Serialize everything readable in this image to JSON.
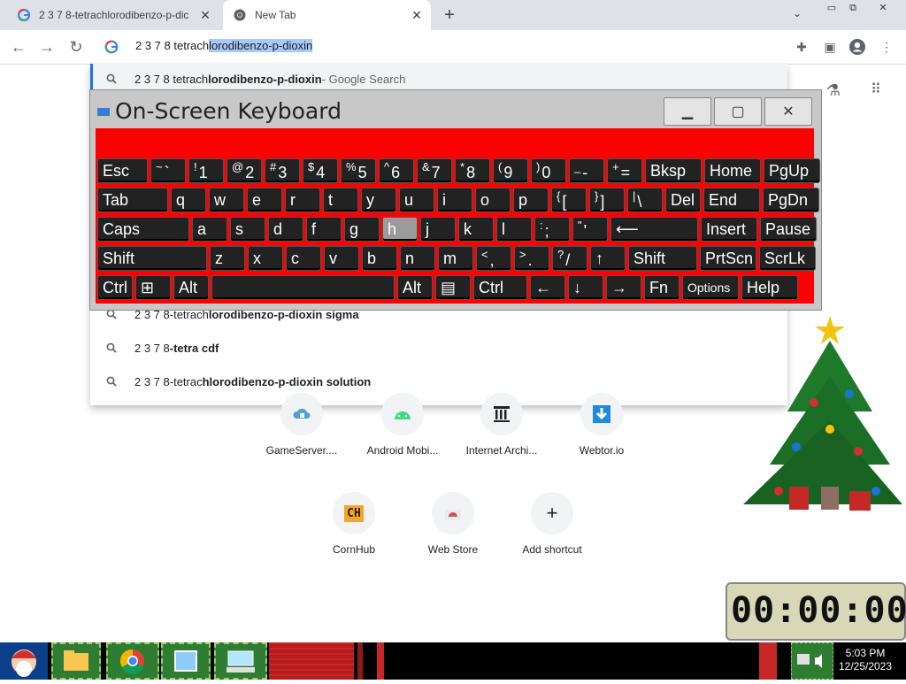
{
  "tabs": [
    {
      "title": "2 3 7 8-tetrachlorodibenzo-p-dic",
      "active": false
    },
    {
      "title": "New Tab",
      "active": true
    }
  ],
  "new_tab_symbol": "+",
  "omnibox": {
    "text_prefix": "2 3 7 8 tetrach",
    "text_selected": "lorodibenzo-p-dioxin"
  },
  "suggestions": [
    {
      "plain": "2 3 7 8 tetrach",
      "bold": "lorodibenzo-p-dioxin",
      "suffix": " - Google Search"
    },
    {
      "plain": "2 3 7 8-tetrach",
      "bold": "lorodibenzo-p-dioxin sigma",
      "suffix": ""
    },
    {
      "plain": "2 3 7 8",
      "bold": "-tetra cdf",
      "suffix": ""
    },
    {
      "plain": "2 3 7 8-tetrac",
      "bold": "hlorodibenzo-p-dioxin solution",
      "suffix": ""
    }
  ],
  "osk": {
    "title": "On-Screen Keyboard",
    "rows": [
      [
        {
          "l": "Esc"
        },
        {
          "s": "~",
          "l": "`"
        },
        {
          "s": "!",
          "l": "1"
        },
        {
          "s": "@",
          "l": "2"
        },
        {
          "s": "#",
          "l": "3"
        },
        {
          "s": "$",
          "l": "4"
        },
        {
          "s": "%",
          "l": "5"
        },
        {
          "s": "^",
          "l": "6"
        },
        {
          "s": "&",
          "l": "7"
        },
        {
          "s": "*",
          "l": "8"
        },
        {
          "s": "(",
          "l": "9"
        },
        {
          "s": ")",
          "l": "0"
        },
        {
          "s": "_",
          "l": "-"
        },
        {
          "s": "+",
          "l": "="
        },
        {
          "l": "Bksp"
        },
        {
          "l": "Home"
        },
        {
          "l": "PgUp"
        }
      ],
      [
        {
          "l": "Tab"
        },
        {
          "l": "q"
        },
        {
          "l": "w"
        },
        {
          "l": "e"
        },
        {
          "l": "r"
        },
        {
          "l": "t"
        },
        {
          "l": "y"
        },
        {
          "l": "u"
        },
        {
          "l": "i"
        },
        {
          "l": "o"
        },
        {
          "l": "p"
        },
        {
          "s": "{",
          "l": "["
        },
        {
          "s": "}",
          "l": "]"
        },
        {
          "s": "|",
          "l": "\\"
        },
        {
          "l": "Del"
        },
        {
          "l": "End"
        },
        {
          "l": "PgDn"
        }
      ],
      [
        {
          "l": "Caps"
        },
        {
          "l": "a"
        },
        {
          "l": "s"
        },
        {
          "l": "d"
        },
        {
          "l": "f"
        },
        {
          "l": "g"
        },
        {
          "l": "h"
        },
        {
          "l": "j"
        },
        {
          "l": "k"
        },
        {
          "l": "l"
        },
        {
          "s": ":",
          "l": ";"
        },
        {
          "s": "\"",
          "l": "'"
        },
        {
          "l": "⟵"
        },
        {
          "l": "Insert"
        },
        {
          "l": "Pause"
        }
      ],
      [
        {
          "l": "Shift"
        },
        {
          "l": "z"
        },
        {
          "l": "x"
        },
        {
          "l": "c"
        },
        {
          "l": "v"
        },
        {
          "l": "b"
        },
        {
          "l": "n"
        },
        {
          "l": "m"
        },
        {
          "s": "<",
          "l": ","
        },
        {
          "s": ">",
          "l": "."
        },
        {
          "s": "?",
          "l": "/"
        },
        {
          "l": "↑"
        },
        {
          "l": "Shift"
        },
        {
          "l": "PrtScn"
        },
        {
          "l": "ScrLk"
        }
      ],
      [
        {
          "l": "Ctrl"
        },
        {
          "l": "⊞"
        },
        {
          "l": "Alt"
        },
        {
          "l": ""
        },
        {
          "l": "Alt"
        },
        {
          "l": "▤"
        },
        {
          "l": "Ctrl"
        },
        {
          "l": "←"
        },
        {
          "l": "↓"
        },
        {
          "l": "→"
        },
        {
          "l": "Fn"
        },
        {
          "l": "Options"
        },
        {
          "l": "Help"
        }
      ]
    ]
  },
  "shortcuts_row1": [
    {
      "label": "GameServer....",
      "icon": "cloud-lock-icon"
    },
    {
      "label": "Android Mobi...",
      "icon": "android-icon"
    },
    {
      "label": "Internet Archi...",
      "icon": "archive-icon"
    },
    {
      "label": "Webtor.io",
      "icon": "download-arrow-icon"
    }
  ],
  "shortcuts_row2": [
    {
      "label": "CornHub",
      "icon": "ch-icon",
      "icon_text": "CH"
    },
    {
      "label": "Web Store",
      "icon": "web-store-icon"
    },
    {
      "label": "Add shortcut",
      "icon": "plus-icon",
      "icon_text": "+"
    }
  ],
  "clock": {
    "digits": "00:00:00"
  },
  "tray": {
    "time": "5:03 PM",
    "date": "12/25/2023"
  },
  "colors": {
    "osk_background": "#ff0000",
    "selection": "#a8c7fa",
    "accent": "#1a73e8"
  }
}
